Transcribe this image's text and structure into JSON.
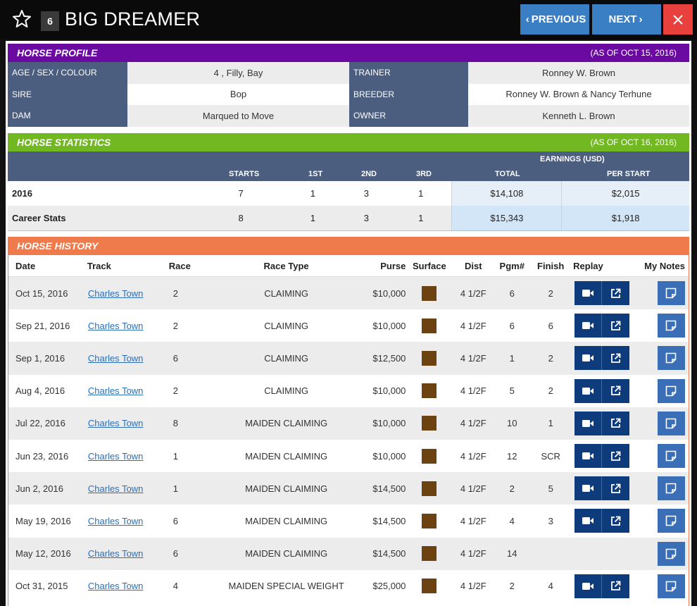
{
  "header": {
    "program_number": "6",
    "horse_name": "BIG DREAMER",
    "prev_label": "PREVIOUS",
    "next_label": "NEXT",
    "prev_chevron": "‹",
    "next_chevron": "›"
  },
  "profile": {
    "title": "HORSE PROFILE",
    "as_of": "(AS OF OCT 15, 2016)",
    "rows": [
      {
        "l1": "AGE / SEX / COLOUR",
        "v1": "4 , Filly, Bay",
        "l2": "TRAINER",
        "v2": "Ronney W. Brown"
      },
      {
        "l1": "SIRE",
        "v1": "Bop",
        "l2": "BREEDER",
        "v2": "Ronney W. Brown & Nancy Terhune"
      },
      {
        "l1": "DAM",
        "v1": "Marqued to Move",
        "l2": "OWNER",
        "v2": "Kenneth L. Brown"
      }
    ]
  },
  "statistics": {
    "title": "HORSE STATISTICS",
    "as_of": "(AS OF OCT 16, 2016)",
    "earnings_label": "EARNINGS (USD)",
    "columns": {
      "starts": "STARTS",
      "first": "1ST",
      "second": "2ND",
      "third": "3RD",
      "total": "TOTAL",
      "per_start": "PER START"
    },
    "rows": [
      {
        "label": "2016",
        "starts": "7",
        "first": "1",
        "second": "3",
        "third": "1",
        "total": "$14,108",
        "per_start": "$2,015"
      },
      {
        "label": "Career Stats",
        "starts": "8",
        "first": "1",
        "second": "3",
        "third": "1",
        "total": "$15,343",
        "per_start": "$1,918"
      }
    ]
  },
  "history": {
    "title": "HORSE HISTORY",
    "columns": {
      "date": "Date",
      "track": "Track",
      "race": "Race",
      "race_type": "Race Type",
      "purse": "Purse",
      "surface": "Surface",
      "dist": "Dist",
      "pgm": "Pgm#",
      "finish": "Finish",
      "replay": "Replay",
      "notes": "My Notes"
    },
    "surface_color": "#6b4210",
    "rows": [
      {
        "date": "Oct 15, 2016",
        "track": "Charles Town",
        "race": "2",
        "race_type": "CLAIMING",
        "purse": "$10,000",
        "dist": "4 1/2F",
        "pgm": "6",
        "finish": "2",
        "replay": true
      },
      {
        "date": "Sep 21, 2016",
        "track": "Charles Town",
        "race": "2",
        "race_type": "CLAIMING",
        "purse": "$10,000",
        "dist": "4 1/2F",
        "pgm": "6",
        "finish": "6",
        "replay": true
      },
      {
        "date": "Sep 1, 2016",
        "track": "Charles Town",
        "race": "6",
        "race_type": "CLAIMING",
        "purse": "$12,500",
        "dist": "4 1/2F",
        "pgm": "1",
        "finish": "2",
        "replay": true
      },
      {
        "date": "Aug 4, 2016",
        "track": "Charles Town",
        "race": "2",
        "race_type": "CLAIMING",
        "purse": "$10,000",
        "dist": "4 1/2F",
        "pgm": "5",
        "finish": "2",
        "replay": true
      },
      {
        "date": "Jul 22, 2016",
        "track": "Charles Town",
        "race": "8",
        "race_type": "MAIDEN CLAIMING",
        "purse": "$10,000",
        "dist": "4 1/2F",
        "pgm": "10",
        "finish": "1",
        "replay": true
      },
      {
        "date": "Jun 23, 2016",
        "track": "Charles Town",
        "race": "1",
        "race_type": "MAIDEN CLAIMING",
        "purse": "$10,000",
        "dist": "4 1/2F",
        "pgm": "12",
        "finish": "SCR",
        "replay": true
      },
      {
        "date": "Jun 2, 2016",
        "track": "Charles Town",
        "race": "1",
        "race_type": "MAIDEN CLAIMING",
        "purse": "$14,500",
        "dist": "4 1/2F",
        "pgm": "2",
        "finish": "5",
        "replay": true
      },
      {
        "date": "May 19, 2016",
        "track": "Charles Town",
        "race": "6",
        "race_type": "MAIDEN CLAIMING",
        "purse": "$14,500",
        "dist": "4 1/2F",
        "pgm": "4",
        "finish": "3",
        "replay": true
      },
      {
        "date": "May 12, 2016",
        "track": "Charles Town",
        "race": "6",
        "race_type": "MAIDEN CLAIMING",
        "purse": "$14,500",
        "dist": "4 1/2F",
        "pgm": "14",
        "finish": "",
        "replay": false
      },
      {
        "date": "Oct 31, 2015",
        "track": "Charles Town",
        "race": "4",
        "race_type": "MAIDEN SPECIAL WEIGHT",
        "purse": "$25,000",
        "dist": "4 1/2F",
        "pgm": "2",
        "finish": "4",
        "replay": true
      }
    ]
  }
}
